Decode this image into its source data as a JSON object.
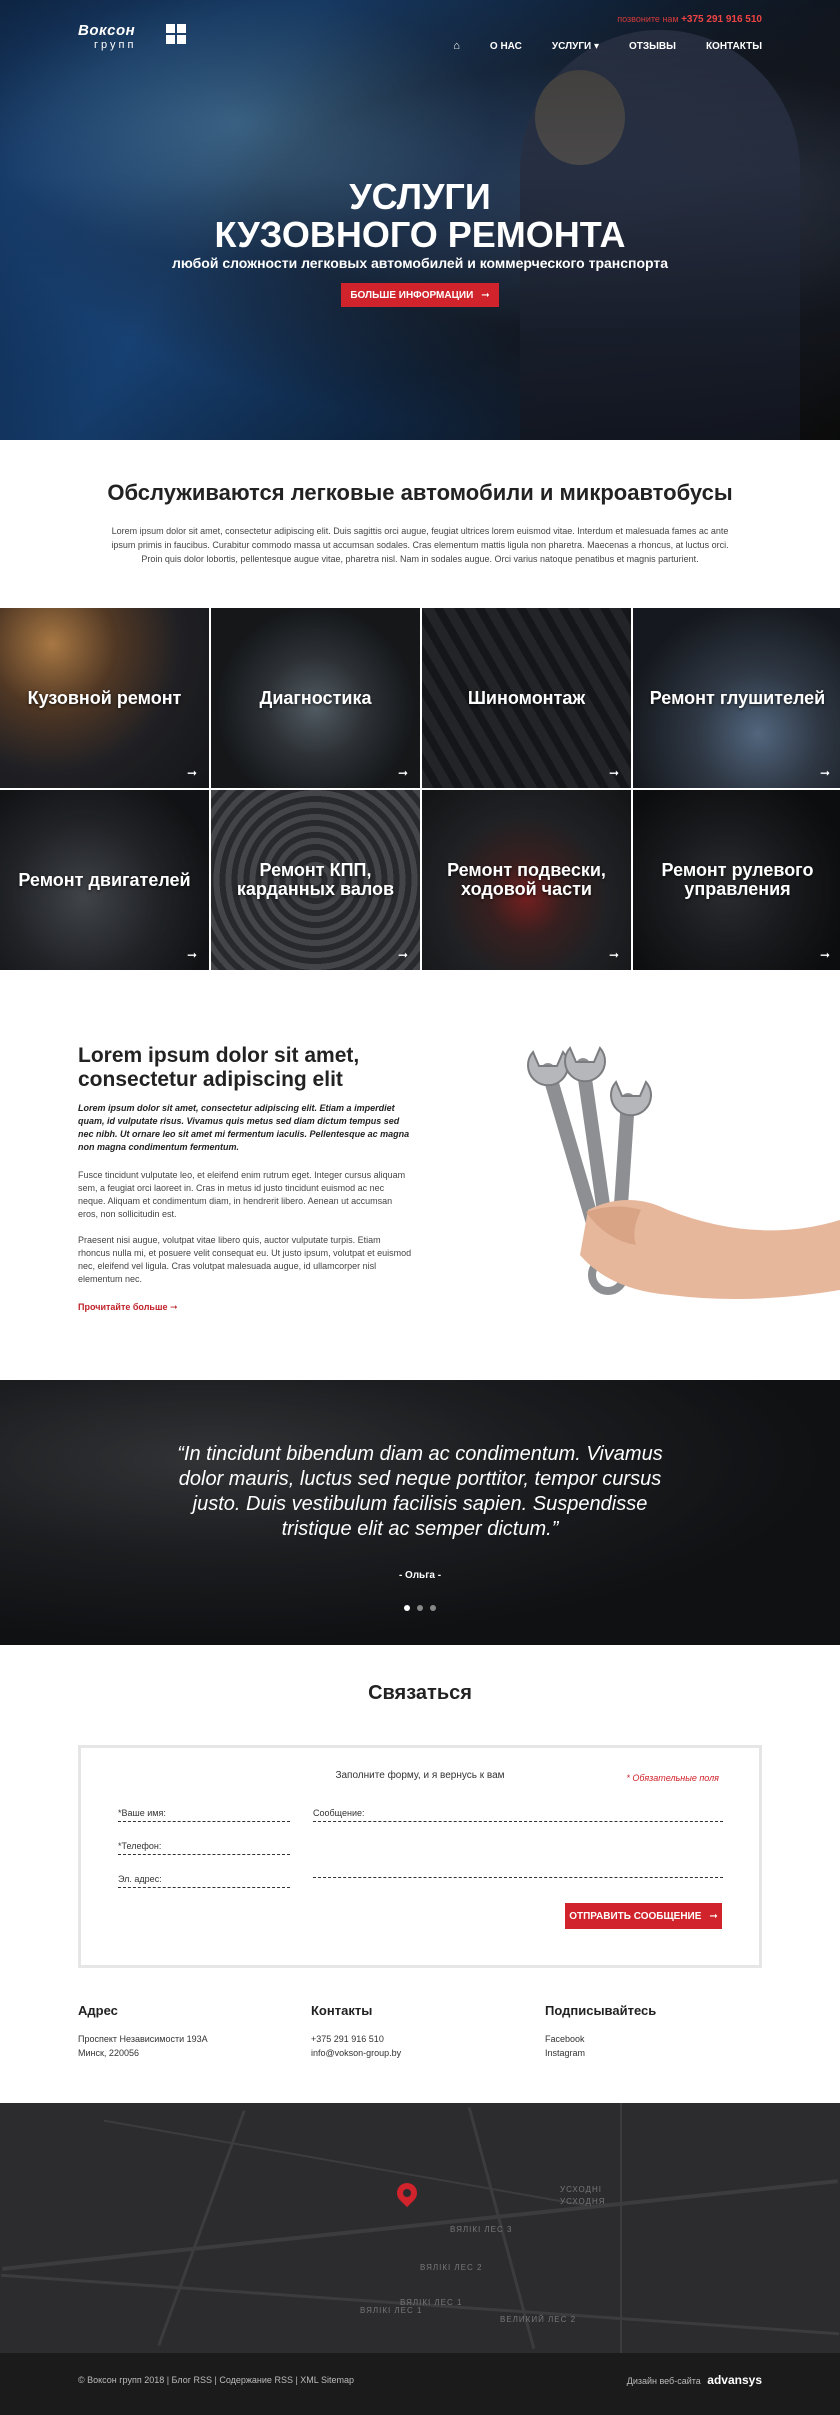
{
  "header": {
    "logo_line1": "Воксон",
    "logo_line2": "групп",
    "phone_label": "позвоните нам",
    "phone": "+375 291 916 510",
    "nav": [
      {
        "label": "О НАС"
      },
      {
        "label": "УСЛУГИ ▾"
      },
      {
        "label": "ОТЗЫВЫ"
      },
      {
        "label": "КОНТАКТЫ"
      }
    ]
  },
  "hero": {
    "title_line1": "УСЛУГИ",
    "title_line2": "КУЗОВНОГО РЕМОНТА",
    "subtitle": "любой сложности легковых автомобилей и коммерческого транспорта",
    "button": "БОЛЬШЕ ИНФОРМАЦИИ"
  },
  "intro": {
    "title": "Обслуживаются легковые автомобили и микроавтобусы",
    "text": "Lorem ipsum dolor sit amet, consectetur adipiscing elit. Duis sagittis orci augue, feugiat ultrices lorem euismod vitae. Interdum et malesuada fames ac ante ipsum primis in faucibus. Curabitur commodo massa ut accumsan sodales. Cras elementum mattis ligula non pharetra. Maecenas a rhoncus, at luctus orci. Proin quis dolor lobortis, pellentesque augue vitae, pharetra nisl. Nam in sodales augue. Orci varius natoque penatibus et magnis parturient."
  },
  "services": [
    {
      "label": "Кузовной ремонт"
    },
    {
      "label": "Диагностика"
    },
    {
      "label": "Шиномонтаж"
    },
    {
      "label": "Ремонт глушителей"
    },
    {
      "label": "Ремонт двигателей"
    },
    {
      "label": "Ремонт КПП, карданных валов"
    },
    {
      "label": "Ремонт подвески, ходовой части"
    },
    {
      "label": "Ремонт рулевого управления"
    }
  ],
  "about": {
    "title": "Lorem ipsum dolor sit amet, consectetur adipiscing elit",
    "lead": "Lorem ipsum dolor sit amet, consectetur adipiscing elit. Etiam a imperdiet quam, id vulputate risus. Vivamus quis metus sed diam dictum tempus sed nec nibh. Ut ornare leo sit amet mi fermentum iaculis. Pellentesque ac magna non magna condimentum fermentum.",
    "p1": "Fusce tincidunt vulputate leo, et eleifend enim rutrum eget. Integer cursus aliquam sem, a feugiat orci laoreet in. Cras in metus id justo tincidunt euismod ac nec neque. Aliquam et condimentum diam, in hendrerit libero. Aenean ut accumsan eros, non sollicitudin est.",
    "p2": "Praesent nisi augue, volutpat vitae libero quis, auctor vulputate turpis. Etiam rhoncus nulla mi, et posuere velit consequat eu. Ut justo ipsum, volutpat et euismod nec, eleifend vel ligula. Cras volutpat malesuada augue, id ullamcorper nisl elementum nec.",
    "more": "Прочитайте больше"
  },
  "testimonial": {
    "quote": "“In tincidunt bibendum diam ac condimentum. Vivamus dolor mauris, luctus sed neque porttitor, tempor cursus justo. Duis vestibulum facilisis sapien. Suspendisse tristique elit ac semper dictum.”",
    "author": "- Ольга -"
  },
  "contact": {
    "title": "Связаться",
    "form_title": "Заполните форму, и я вернусь к вам",
    "required_note": "* Обязательные поля",
    "name_label": "*Ваше имя:",
    "phone_label": "*Телефон:",
    "email_label": "Эл. адрес:",
    "message_label": "Сообщение:",
    "submit": "ОТПРАВИТЬ СООБЩЕНИЕ"
  },
  "footer": {
    "address_title": "Адрес",
    "address_line1": "Проспект Независимости 193А",
    "address_line2": "Минск, 220056",
    "contacts_title": "Контакты",
    "contact_phone": "+375 291 916 510",
    "contact_email": "info@vokson-group.by",
    "subscribe_title": "Подписывайтесь",
    "social1": "Facebook",
    "social2": "Instagram",
    "map_labels": [
      "УСХОДНІ",
      "УСХОДНЯ",
      "ВЯЛІКІ ЛЕС 3",
      "ВЯЛІКІ ЛЕС 2",
      "ВЯЛІКІ ЛЕС 1",
      "ВЯЛІКІ ЛЕС 1",
      "ВЕЛИКИЙ ЛЕС 2"
    ],
    "copyright": "© Воксон групп 2018  |  Блог RSS | Содержание RSS | XML Sitemap",
    "designer_label": "Дизайн веб-сайта",
    "designer": "advansys"
  }
}
